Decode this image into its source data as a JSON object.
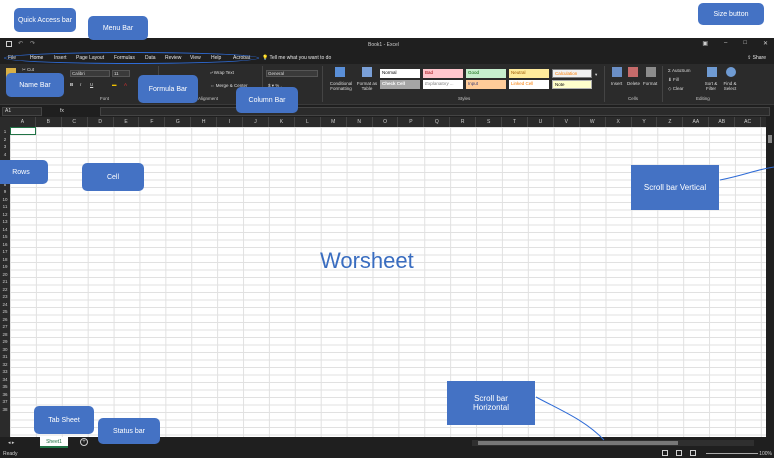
{
  "app": {
    "doc_title": "Book1 - Excel",
    "window_controls": [
      "restore-icon",
      "minimize-icon",
      "maximize-icon",
      "close-icon"
    ]
  },
  "menu": {
    "tabs": [
      "File",
      "Home",
      "Insert",
      "Page Layout",
      "Formulas",
      "Data",
      "Review",
      "View",
      "Help",
      "Acrobat"
    ],
    "active_tab": "Home",
    "tell_me": "Tell me what you want to do",
    "share": "Share"
  },
  "ribbon": {
    "cut": "Cut",
    "font_name": "Calibri",
    "font_size": "11",
    "wrap_text": "Wrap Text",
    "merge_center": "Merge & Center",
    "number_format": "General",
    "conditional_formatting": "Conditional Formatting",
    "format_as_table": "Format as Table",
    "styles": {
      "normal": "Normal",
      "bad": "Bad",
      "good": "Good",
      "neutral": "Neutral",
      "calculation": "Calculation",
      "check_cell": "Check Cell",
      "explanatory": "Explanatory ...",
      "input": "Input",
      "linked_cell": "Linked Cell",
      "note": "Note"
    },
    "insert": "Insert",
    "delete": "Delete",
    "format": "Format",
    "autosum": "AutoSum",
    "fill": "Fill",
    "clear": "Clear",
    "sort_filter": "Sort & Filter",
    "find_select": "Find & Select",
    "groups": {
      "font": "Font",
      "alignment": "Alignment",
      "number": "Number",
      "styles": "Styles",
      "cells": "Cells",
      "editing": "Editing"
    }
  },
  "formula_bar": {
    "name_box": "A1",
    "fx": "fx"
  },
  "columns": [
    "A",
    "B",
    "C",
    "D",
    "E",
    "F",
    "G",
    "H",
    "I",
    "J",
    "K",
    "L",
    "M",
    "N",
    "O",
    "P",
    "Q",
    "R",
    "S",
    "T",
    "U",
    "V",
    "W",
    "X",
    "Y",
    "Z",
    "AA",
    "AB",
    "AC"
  ],
  "rows": [
    "1",
    "2",
    "3",
    "4",
    "5",
    "6",
    "7",
    "8",
    "9",
    "10",
    "11",
    "12",
    "13",
    "14",
    "15",
    "16",
    "17",
    "18",
    "19",
    "20",
    "21",
    "22",
    "23",
    "24",
    "25",
    "26",
    "27",
    "28",
    "29",
    "30",
    "31",
    "32",
    "33",
    "34",
    "35",
    "36",
    "37",
    "38"
  ],
  "sheet": {
    "tab_name": "Sheet1",
    "status": "Ready",
    "zoom": "100%"
  },
  "annotations": {
    "quick_access": "Quick Access bar",
    "menu_bar": "Menu Bar",
    "size_button": "Size button",
    "name_bar": "Name Bar",
    "formula_bar": "Formula Bar",
    "column_bar": "Column Bar",
    "rows": "Rows",
    "cell": "Cell",
    "scroll_vertical": "Scroll bar Vertical",
    "worksheet": "Worsheet",
    "scroll_horizontal": "Scroll bar Horizontal",
    "tab_sheet": "Tab Sheet",
    "status_bar": "Status bar"
  },
  "colors": {
    "accent_green": "#217346",
    "callout_blue": "#4472c4",
    "chrome_dark": "#1f1f1f"
  }
}
